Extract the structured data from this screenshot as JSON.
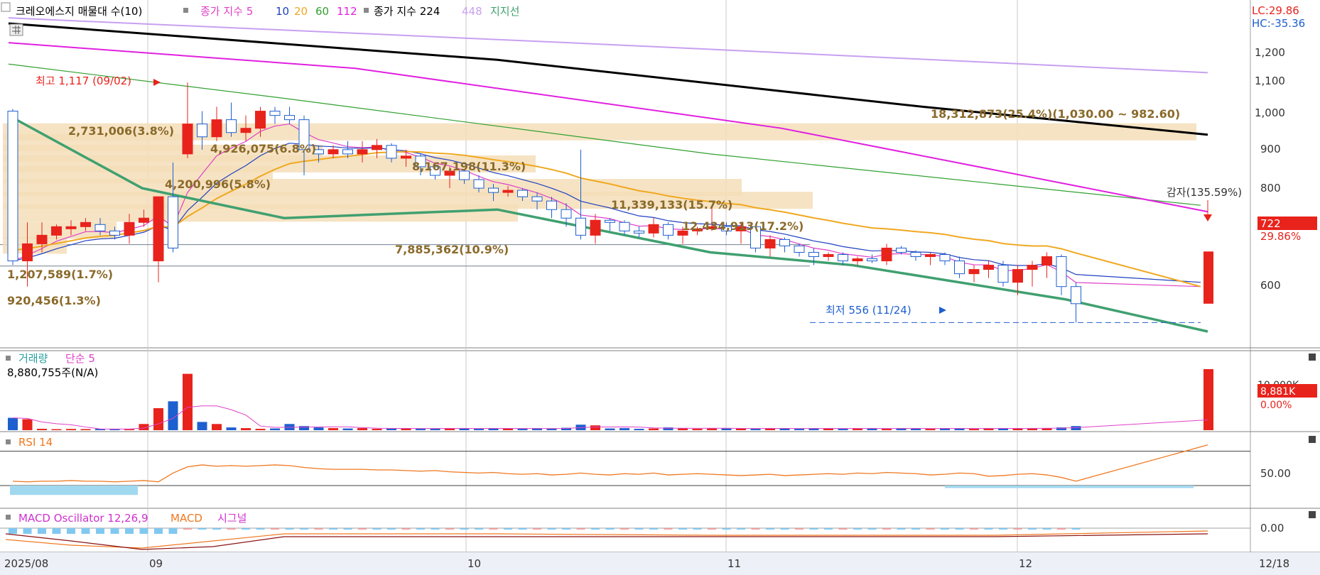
{
  "toolbar": {
    "title": "크레오에스지 매물대 수(10)",
    "ma_label": "종가 지수 5",
    "ma_periods": [
      "10",
      "20",
      "60",
      "112"
    ],
    "ma2_label": "종가 지수 224",
    "ma2_extra": "448",
    "support_label": "지지선"
  },
  "colors": {
    "up": "#e8231c",
    "down": "#1e5fd0",
    "ma5": "#e040c8",
    "ma10": "#2040c0",
    "ma20": "#f0a820",
    "ma60": "#30a030",
    "ma112": "#e020e0",
    "ma224": "#000000",
    "ma448": "#c8a0f0",
    "support": "#40a070",
    "volume_bar": "#f5deb8",
    "rsi": "#f07820",
    "macd": "#f07820",
    "macd_osc": "#d030d0"
  },
  "price_axis": {
    "ticks": [
      "1,200",
      "1,100",
      "1,000",
      "900",
      "800",
      "600"
    ],
    "lc": "LC:29.86",
    "hc": "HC:-35.36",
    "current_price": "722",
    "current_change": "29.86%"
  },
  "annotations": {
    "high": "최고 1,117 (09/02)",
    "low": "최저 556 (11/24)",
    "reduction": "감자(135.59%)"
  },
  "volume_profile": [
    {
      "label": "18,312,873(25.4%)(1,030.00 ~ 982.60)"
    },
    {
      "label": "2,731,006(3.8%)"
    },
    {
      "label": "4,926,075(6.8%)"
    },
    {
      "label": "8,167,198(11.3%)"
    },
    {
      "label": "4,200,996(5.8%)"
    },
    {
      "label": "11,339,133(15.7%)"
    },
    {
      "label": "12,434,913(17.2%)"
    },
    {
      "label": "7,885,362(10.9%)"
    },
    {
      "label": "1,207,589(1.7%)"
    },
    {
      "label": "920,456(1.3%)"
    }
  ],
  "volume_panel": {
    "label": "거래량",
    "ma_label": "단순 5",
    "last_value": "8,880,755주(N/A)",
    "axis_tick": "10,000K",
    "current": "8,881K",
    "change": "0.00%"
  },
  "rsi_panel": {
    "label": "RSI 14",
    "tick": "50.00"
  },
  "macd_panel": {
    "label": "MACD Oscillator 12,26,9",
    "macd_label": "MACD",
    "signal_label": "시그널",
    "tick": "0.00"
  },
  "x_axis": {
    "labels": [
      "2025/08",
      "09",
      "10",
      "11",
      "12",
      "12/18"
    ]
  },
  "chart_data": {
    "type": "candlestick",
    "title": "크레오에스지",
    "y_range": [
      556,
      1260
    ],
    "candles": [
      [
        1050,
        1055,
        690,
        700
      ],
      [
        700,
        790,
        640,
        740
      ],
      [
        740,
        790,
        720,
        760
      ],
      [
        760,
        785,
        750,
        780
      ],
      [
        775,
        795,
        760,
        780
      ],
      [
        780,
        800,
        770,
        790
      ],
      [
        785,
        800,
        760,
        770
      ],
      [
        770,
        780,
        750,
        760
      ],
      [
        760,
        810,
        740,
        790
      ],
      [
        790,
        820,
        780,
        800
      ],
      [
        700,
        850,
        650,
        850
      ],
      [
        850,
        930,
        720,
        730
      ],
      [
        950,
        1117,
        940,
        1020
      ],
      [
        1020,
        1050,
        960,
        990
      ],
      [
        990,
        1060,
        980,
        1030
      ],
      [
        1030,
        1070,
        990,
        1000
      ],
      [
        1000,
        1040,
        980,
        1010
      ],
      [
        1010,
        1060,
        990,
        1050
      ],
      [
        1050,
        1060,
        1020,
        1040
      ],
      [
        1040,
        1060,
        1020,
        1030
      ],
      [
        1030,
        1040,
        900,
        960
      ],
      [
        960,
        970,
        930,
        950
      ],
      [
        950,
        970,
        940,
        960
      ],
      [
        960,
        980,
        940,
        950
      ],
      [
        950,
        980,
        930,
        960
      ],
      [
        960,
        985,
        940,
        970
      ],
      [
        970,
        975,
        930,
        940
      ],
      [
        940,
        960,
        920,
        945
      ],
      [
        945,
        950,
        900,
        920
      ],
      [
        920,
        930,
        890,
        900
      ],
      [
        900,
        920,
        870,
        910
      ],
      [
        910,
        915,
        880,
        890
      ],
      [
        890,
        900,
        860,
        870
      ],
      [
        870,
        880,
        840,
        860
      ],
      [
        860,
        875,
        850,
        865
      ],
      [
        865,
        870,
        840,
        850
      ],
      [
        850,
        860,
        820,
        840
      ],
      [
        840,
        850,
        800,
        820
      ],
      [
        820,
        835,
        780,
        800
      ],
      [
        800,
        960,
        750,
        760
      ],
      [
        760,
        810,
        740,
        795
      ],
      [
        795,
        800,
        770,
        790
      ],
      [
        790,
        795,
        760,
        770
      ],
      [
        770,
        780,
        755,
        765
      ],
      [
        765,
        800,
        755,
        785
      ],
      [
        785,
        790,
        750,
        760
      ],
      [
        760,
        780,
        740,
        770
      ],
      [
        770,
        780,
        760,
        775
      ],
      [
        775,
        830,
        770,
        780
      ],
      [
        780,
        790,
        760,
        770
      ],
      [
        770,
        790,
        740,
        780
      ],
      [
        780,
        785,
        720,
        730
      ],
      [
        730,
        760,
        710,
        750
      ],
      [
        750,
        755,
        720,
        735
      ],
      [
        735,
        740,
        710,
        720
      ],
      [
        720,
        730,
        690,
        710
      ],
      [
        710,
        720,
        700,
        715
      ],
      [
        715,
        720,
        690,
        700
      ],
      [
        700,
        710,
        690,
        705
      ],
      [
        705,
        715,
        695,
        700
      ],
      [
        700,
        740,
        690,
        730
      ],
      [
        730,
        735,
        715,
        720
      ],
      [
        720,
        725,
        700,
        710
      ],
      [
        710,
        720,
        690,
        715
      ],
      [
        715,
        720,
        690,
        700
      ],
      [
        700,
        710,
        660,
        670
      ],
      [
        670,
        690,
        650,
        680
      ],
      [
        680,
        700,
        660,
        690
      ],
      [
        690,
        700,
        640,
        650
      ],
      [
        650,
        690,
        620,
        680
      ],
      [
        680,
        700,
        640,
        690
      ],
      [
        690,
        720,
        660,
        710
      ],
      [
        710,
        715,
        620,
        640
      ],
      [
        640,
        650,
        556,
        600
      ]
    ],
    "last_candle": [
      600,
      722,
      600,
      722
    ],
    "volume_K": [
      1800,
      1600,
      200,
      150,
      180,
      160,
      200,
      150,
      140,
      900,
      3200,
      4200,
      8200,
      1200,
      900,
      400,
      300,
      200,
      250,
      900,
      600,
      400,
      300,
      250,
      300,
      200,
      250,
      300,
      200,
      250,
      300,
      250,
      200,
      300,
      250,
      200,
      300,
      200,
      350,
      800,
      700,
      250,
      300,
      200,
      250,
      400,
      300,
      200,
      250,
      300,
      250,
      200,
      300,
      250,
      200,
      300,
      250,
      200,
      300,
      250,
      200,
      300,
      250,
      200,
      300,
      250,
      200,
      300,
      250,
      300,
      250,
      300,
      400,
      600
    ],
    "volume_last_K": 8881,
    "rsi_range": [
      0,
      100
    ],
    "rsi": [
      22,
      21,
      22,
      22,
      23,
      22,
      22,
      21,
      22,
      23,
      21,
      35,
      45,
      48,
      46,
      47,
      46,
      47,
      48,
      47,
      44,
      42,
      41,
      41,
      41,
      40,
      40,
      39,
      38,
      39,
      37,
      36,
      35,
      36,
      34,
      33,
      34,
      32,
      33,
      35,
      33,
      32,
      34,
      33,
      35,
      32,
      33,
      34,
      33,
      32,
      31,
      32,
      33,
      31,
      32,
      33,
      34,
      33,
      35,
      34,
      36,
      35,
      34,
      32,
      33,
      35,
      34,
      30,
      31,
      33,
      34,
      32,
      28,
      22
    ],
    "rsi_last": 90
  }
}
